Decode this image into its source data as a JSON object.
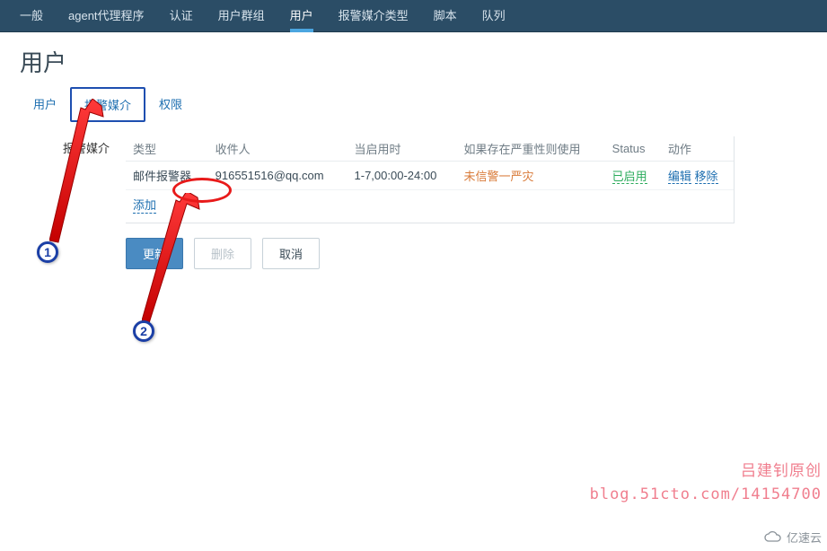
{
  "topnav": {
    "items": [
      {
        "label": "一般"
      },
      {
        "label": "agent代理程序"
      },
      {
        "label": "认证"
      },
      {
        "label": "用户群组"
      },
      {
        "label": "用户",
        "active": true
      },
      {
        "label": "报警媒介类型"
      },
      {
        "label": "脚本"
      },
      {
        "label": "队列"
      }
    ]
  },
  "page_title": "用户",
  "subtabs": [
    {
      "label": "用户"
    },
    {
      "label": "报警媒介",
      "selected": true
    },
    {
      "label": "权限"
    }
  ],
  "field_label": "报警媒介",
  "table": {
    "headers": [
      "类型",
      "收件人",
      "当启用时",
      "如果存在严重性则使用",
      "Status",
      "动作"
    ],
    "rows": [
      {
        "type": "邮件报警器",
        "recipient": "916551516@qq.com",
        "when": "1-7,00:00-24:00",
        "severity": "未信警一严灾",
        "status": "已启用",
        "actions": {
          "edit": "编辑",
          "remove": "移除"
        }
      }
    ],
    "add_label": "添加"
  },
  "buttons": {
    "update": "更新",
    "delete": "删除",
    "cancel": "取消"
  },
  "annotations": {
    "num1": "1",
    "num2": "2"
  },
  "watermark": {
    "line1": "吕建钊原创",
    "line2": "blog.51cto.com/14154700"
  },
  "corner_logo": "亿速云"
}
